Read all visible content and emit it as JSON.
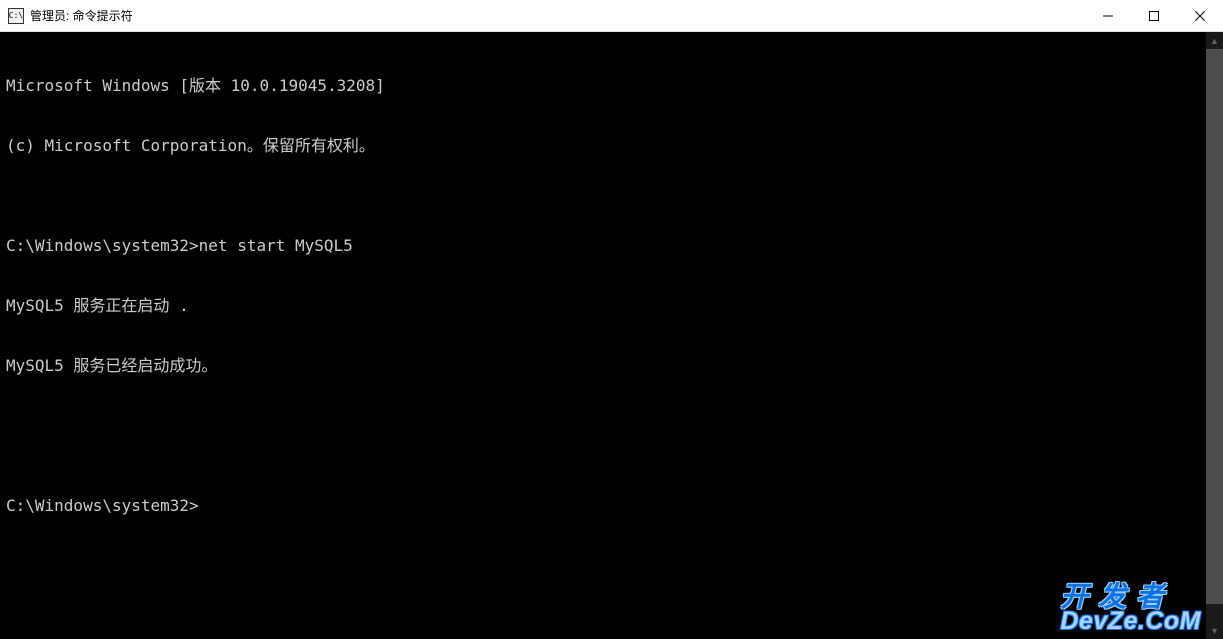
{
  "titlebar": {
    "icon_text": "C:\\",
    "title": "管理员: 命令提示符"
  },
  "terminal": {
    "lines": [
      "Microsoft Windows [版本 10.0.19045.3208]",
      "(c) Microsoft Corporation。保留所有权利。",
      "",
      "C:\\Windows\\system32>net start MySQL5",
      "MySQL5 服务正在启动 .",
      "MySQL5 服务已经启动成功。",
      "",
      "",
      "C:\\Windows\\system32>"
    ]
  },
  "watermark": {
    "top": "开 发 者",
    "bottom": "DevZe.CoM"
  }
}
